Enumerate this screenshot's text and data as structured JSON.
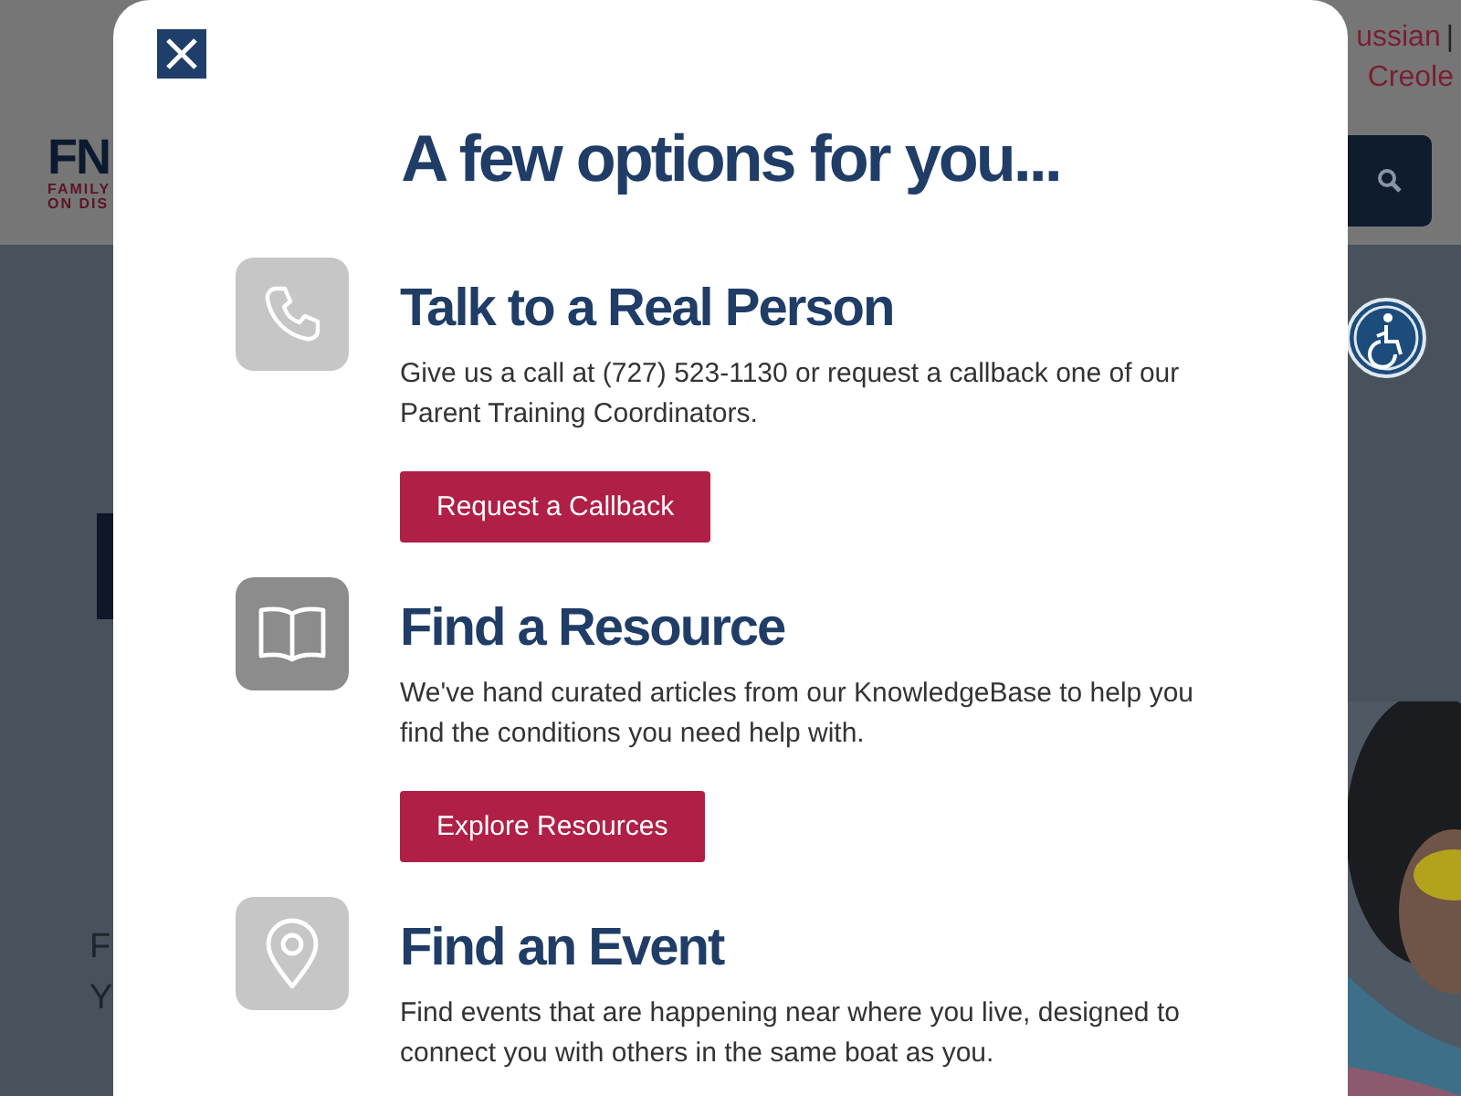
{
  "header": {
    "language_links": [
      "ussian",
      "|",
      "Creole"
    ],
    "logo": {
      "letters": "FN",
      "line_1": "FAMILY",
      "line_2": "ON DIS"
    }
  },
  "hero": {
    "fragments": [
      "F",
      "Y"
    ]
  },
  "modal": {
    "title": "A few options for you...",
    "options": [
      {
        "highlighted": false,
        "heading": "Talk to a Real Person",
        "text": "Give us a call at (727) 523-1130 or request a callback one of our Parent Training Coordinators.",
        "button": "Request a Callback"
      },
      {
        "highlighted": true,
        "heading": "Find a Resource",
        "text": "We've hand curated articles from our KnowledgeBase to help you find the conditions you need help with.",
        "button": "Explore Resources"
      },
      {
        "highlighted": false,
        "heading": "Find an Event",
        "text": "Find events that are happening near where you live, designed to connect you with others in the same boat as you."
      }
    ]
  }
}
